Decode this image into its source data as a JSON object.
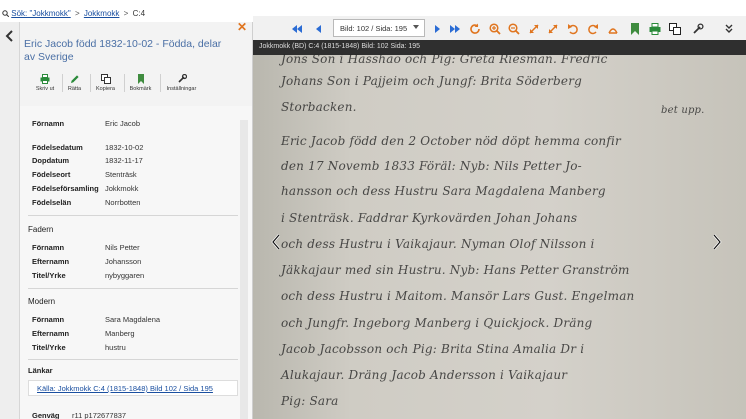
{
  "breadcrumb": {
    "search_link": "Sök: \"Jokkmokk\"",
    "jokkmokk_link": "Jokkmokk",
    "current": "C:4",
    "sep1": ">",
    "sep2": ">"
  },
  "panel": {
    "title": "Eric Jacob född 1832-10-02 - Födda, delar av Sverige",
    "toolbar": [
      {
        "label": "Skriv ut",
        "icon": "print-icon"
      },
      {
        "label": "Rätta",
        "icon": "pencil-icon"
      },
      {
        "label": "Kopiera",
        "icon": "copy-icon"
      },
      {
        "label": "Bokmärk",
        "icon": "bookmark-icon"
      },
      {
        "label": "Inställningar",
        "icon": "wrench-icon"
      }
    ],
    "person": {
      "fornamn_k": "Förnamn",
      "fornamn_v": "Eric Jacob",
      "fodelsedatum_k": "Födelsedatum",
      "fodelsedatum_v": "1832-10-02",
      "dopdatum_k": "Dopdatum",
      "dopdatum_v": "1832-11-17",
      "fodelseort_k": "Födelseort",
      "fodelseort_v": "Stenträsk",
      "forsamling_k": "Födelseförsamling",
      "forsamling_v": "Jokkmokk",
      "lan_k": "Födelselän",
      "lan_v": "Norrbotten"
    },
    "fadern": {
      "heading": "Fadern",
      "fornamn_k": "Förnamn",
      "fornamn_v": "Nils Petter",
      "efternamn_k": "Efternamn",
      "efternamn_v": "Johansson",
      "titel_k": "Titel/Yrke",
      "titel_v": "nybyggaren"
    },
    "modern": {
      "heading": "Modern",
      "fornamn_k": "Förnamn",
      "fornamn_v": "Sara Magdalena",
      "efternamn_k": "Efternamn",
      "efternamn_v": "Manberg",
      "titel_k": "Titel/Yrke",
      "titel_v": "hustru"
    },
    "lankar": {
      "heading": "Länkar",
      "link": "Källa: Jokkmokk C:4 (1815-1848) Bild 102 / Sida 195"
    },
    "genvag": {
      "k": "Genväg",
      "v": "r11 p172677837"
    }
  },
  "viewer": {
    "page_select": "Bild: 102 / Sida: 195",
    "header": "Jokkmokk (BD) C:4 (1815-1848) Bild: 102 Sida: 195",
    "handwriting": [
      "Jons Son i Hasshao och Pig: Greta Riesman. Fredric",
      "Johans Son i Pajjeim och Jungf: Brita Söderberg",
      "Storbacken.",
      "Eric Jacob född den 2 October nöd döpt hemma confir",
      "den 17 Novemb 1833 Föräl: Nyb: Nils Petter Jo-",
      "hansson och dess Hustru Sara Magdalena Manberg",
      "i Stenträsk. Faddrar Kyrkovärden Johan Johans",
      "och dess Hustru i Vaikajaur. Nyman Olof Nilsson i",
      "Jäkkajaur med sin Hustru. Nyb: Hans Petter Granström",
      "och dess Hustru i Maitom. Mansör Lars Gust. Engelman",
      "och Jungfr. Ingeborg Manberg i Quickjock. Dräng",
      "Jacob Jacobsson och Pig: Brita Stina Amalia Dr i",
      "Alukajaur. Dräng Jacob Andersson i Vaikajaur",
      "Pig: Sara"
    ],
    "side_note": "bet upp."
  },
  "colors": {
    "accent": "#1a4fa0",
    "close": "#e0751f",
    "zoom_icons": "#e0751f",
    "nav_icons": "#2b6cd4",
    "bookmark": "#3f8c3f"
  }
}
